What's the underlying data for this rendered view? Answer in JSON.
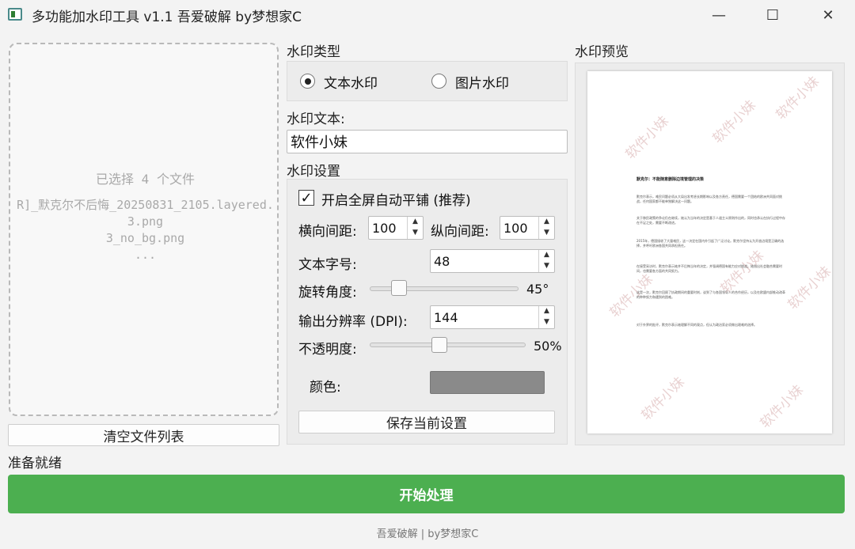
{
  "window": {
    "title": "多功能加水印工具 v1.1 吾爱破解 by梦想家C",
    "minimize_glyph": "—",
    "maximize_glyph": "☐",
    "close_glyph": "✕"
  },
  "files": {
    "count_text": "已选择 4 个文件",
    "lines": [
      "R]_默克尔不后悔_20250831_2105.layered.",
      "3.png",
      "3_no_bg.png",
      "..."
    ],
    "clear_button": "清空文件列表"
  },
  "watermark_type": {
    "label": "水印类型",
    "options": [
      {
        "label": "文本水印",
        "selected": true
      },
      {
        "label": "图片水印",
        "selected": false
      }
    ]
  },
  "watermark_text": {
    "label": "水印文本:",
    "value": "软件小妹"
  },
  "settings": {
    "label": "水印设置",
    "tile_checkbox": {
      "label": "开启全屏自动平铺 (推荐)",
      "checked": true,
      "check_glyph": "✓"
    },
    "h_spacing": {
      "label": "横向间距:",
      "value": "100"
    },
    "v_spacing": {
      "label": "纵向间距:",
      "value": "100"
    },
    "font_size": {
      "label": "文本字号:",
      "value": "48"
    },
    "rotation": {
      "label": "旋转角度:",
      "value": "45°",
      "fraction": 0.16
    },
    "dpi": {
      "label": "输出分辨率 (DPI):",
      "value": "144"
    },
    "opacity": {
      "label": "不透明度:",
      "value": "50%",
      "fraction": 0.44
    },
    "color": {
      "label": "颜色:",
      "hex": "#8a8a8a"
    },
    "save_button": "保存当前设置"
  },
  "preview": {
    "label": "水印预览",
    "watermark_text": "软件小妹",
    "doc_title": "默克尔：不能随意删除边境管理的决策",
    "paragraphs": [
      "默克尔表示，难民问题必须从大局出发考虑长期影响以及各方责任，德国需要一个团结的欧洲共同面对挑战，任何国家都不能单独解决这一问题。",
      "关于移民政策的争论仍在继续，她认为当年的决定是基于人道主义原则作出的，同时也承认在执行过程中存在不足之处，需要不断改进。",
      "2015年，德国接收了大量难民，这一决定在国内外引起了广泛讨论。默克尔坚持认为开放边境是正确的选择，并呼吁欧洲各国共同承担责任。",
      "在接受采访时，默克尔表示她并不后悔当年的决定，并强调德国有能力应对挑战。她指出社会融合需要时间，也需要各方面的共同努力。",
      "这是一次，默克尔回顾了执政期间的重要时刻，谈到了与各国领导人的合作经历，以及在欧盟内部推动改革的种种努力和遇到的困难。",
      "对于外界的批评，默克尔表示她理解不同的观点，但认为政治家必须做出艰难的选择。"
    ],
    "watermark_color": "#e9d2d2"
  },
  "status_text": "准备就绪",
  "start_button": "开始处理",
  "footer": "吾爱破解 | by梦想家C",
  "colors": {
    "accent_green": "#4caf50",
    "window_bg": "#f3f3f3"
  }
}
